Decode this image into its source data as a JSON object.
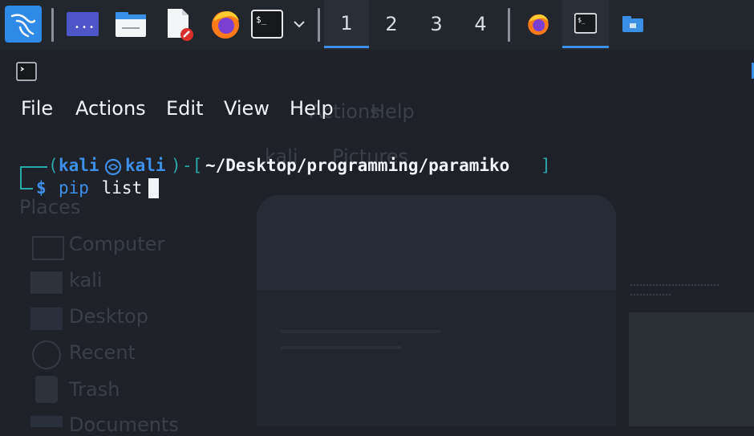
{
  "panel": {
    "workspaces": [
      "1",
      "2",
      "3",
      "4"
    ],
    "active_workspace": "1",
    "icons": [
      "kali-menu-icon",
      "show-desktop-icon",
      "file-manager-icon",
      "text-editor-icon",
      "firefox-icon",
      "terminal-icon",
      "chevron-down-icon"
    ]
  },
  "taskbar": {
    "tasks": [
      "firefox-task",
      "terminal-task",
      "file-manager-task"
    ],
    "active_task": "terminal-task"
  },
  "background_window": {
    "menu_fragments": [
      "Actions",
      "Help"
    ],
    "breadcrumb": [
      "kali",
      "Pictures"
    ],
    "sidebar_heading": "Places",
    "places": [
      "Computer",
      "kali",
      "Desktop",
      "Recent",
      "Trash",
      "Documents"
    ]
  },
  "terminal": {
    "menu": [
      "File",
      "Actions",
      "Edit",
      "View",
      "Help"
    ],
    "prompt": {
      "open_paren": "(",
      "user": "kali",
      "host": "kali",
      "close_paren": ")",
      "dash_bracket": "-[",
      "path": "~/Desktop/programming/paramiko",
      "close_bracket": "]",
      "symbol": "$",
      "command_name": "pip",
      "command_args": " list"
    }
  },
  "colors": {
    "terminal_bg": "#1e2128",
    "prompt_frame": "#2aa8a8",
    "prompt_user": "#3d8fe8",
    "accent": "#3d8fe8",
    "text": "#f2f4f7"
  }
}
